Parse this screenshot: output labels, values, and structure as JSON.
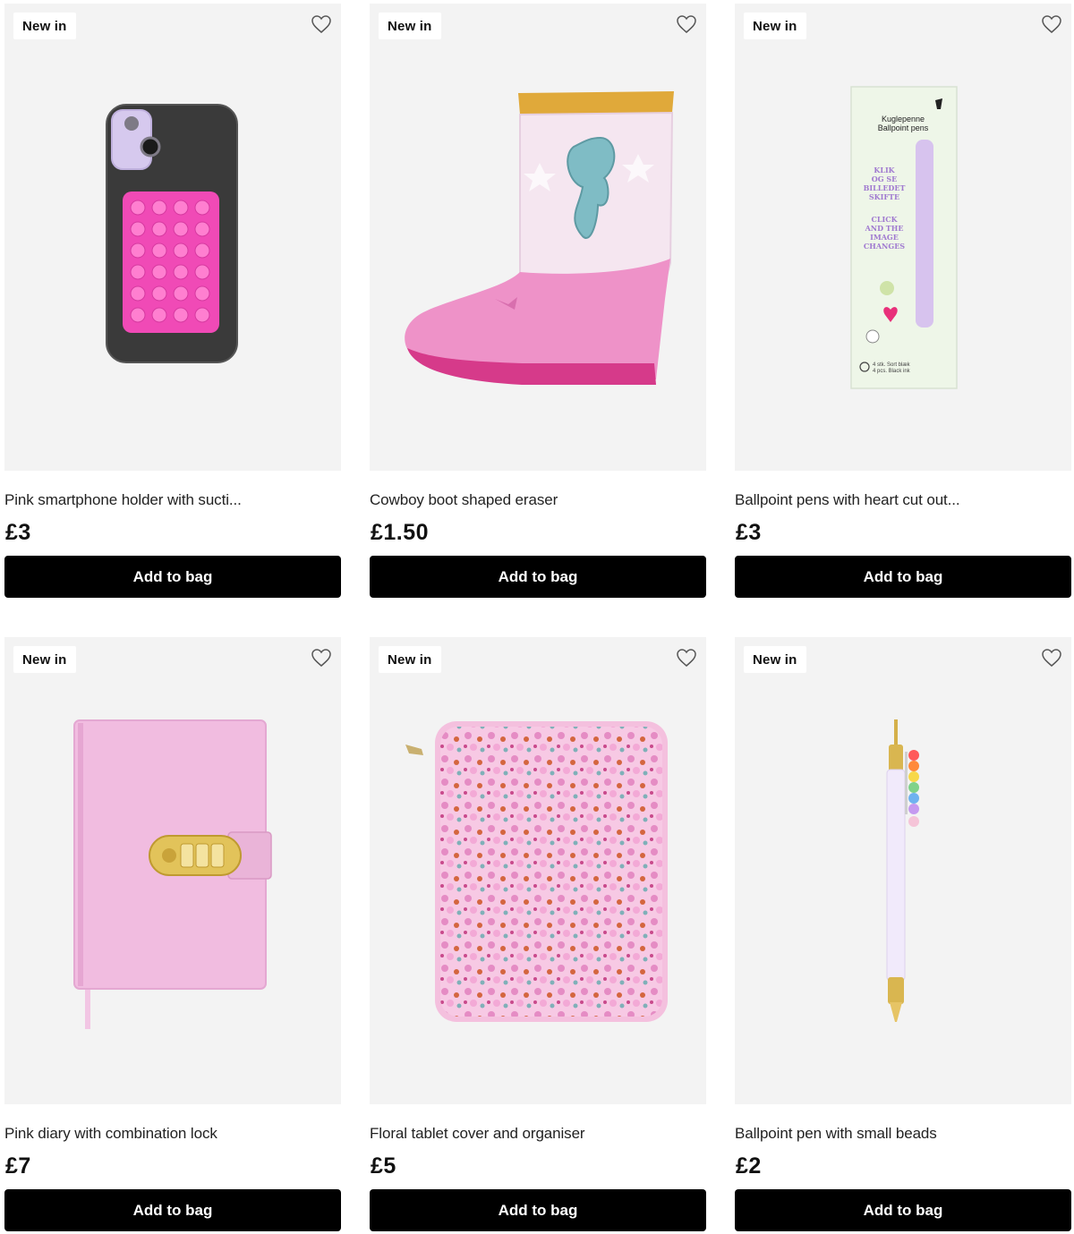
{
  "products": [
    {
      "badge": "New in",
      "title": "Pink smartphone holder with sucti...",
      "price": "£3",
      "button_label": "Add to bag",
      "icon": "phone-holder-image"
    },
    {
      "badge": "New in",
      "title": "Cowboy boot shaped eraser",
      "price": "£1.50",
      "button_label": "Add to bag",
      "icon": "boot-eraser-image"
    },
    {
      "badge": "New in",
      "title": "Ballpoint pens with heart cut out...",
      "price": "£3",
      "button_label": "Add to bag",
      "icon": "pens-box-image",
      "packaging_text": [
        "Kuglepenne",
        "Ballpoint pens",
        "KLIK",
        "OG SE",
        "BILLEDET",
        "SKIFTE",
        "CLICK",
        "AND THE",
        "IMAGE",
        "CHANGES",
        "4 stk. Sort blæk",
        "4 pcs. Black ink"
      ]
    },
    {
      "badge": "New in",
      "title": "Pink diary with combination lock",
      "price": "£7",
      "button_label": "Add to bag",
      "icon": "diary-image"
    },
    {
      "badge": "New in",
      "title": "Floral tablet cover and organiser",
      "price": "£5",
      "button_label": "Add to bag",
      "icon": "tablet-cover-image"
    },
    {
      "badge": "New in",
      "title": "Ballpoint pen with small beads",
      "price": "£2",
      "button_label": "Add to bag",
      "icon": "beaded-pen-image"
    }
  ],
  "colors": {
    "button_bg": "#000000",
    "button_text": "#ffffff",
    "image_bg": "#f3f3f3",
    "badge_bg": "#ffffff"
  },
  "wishlist_icon": "heart-outline-icon"
}
